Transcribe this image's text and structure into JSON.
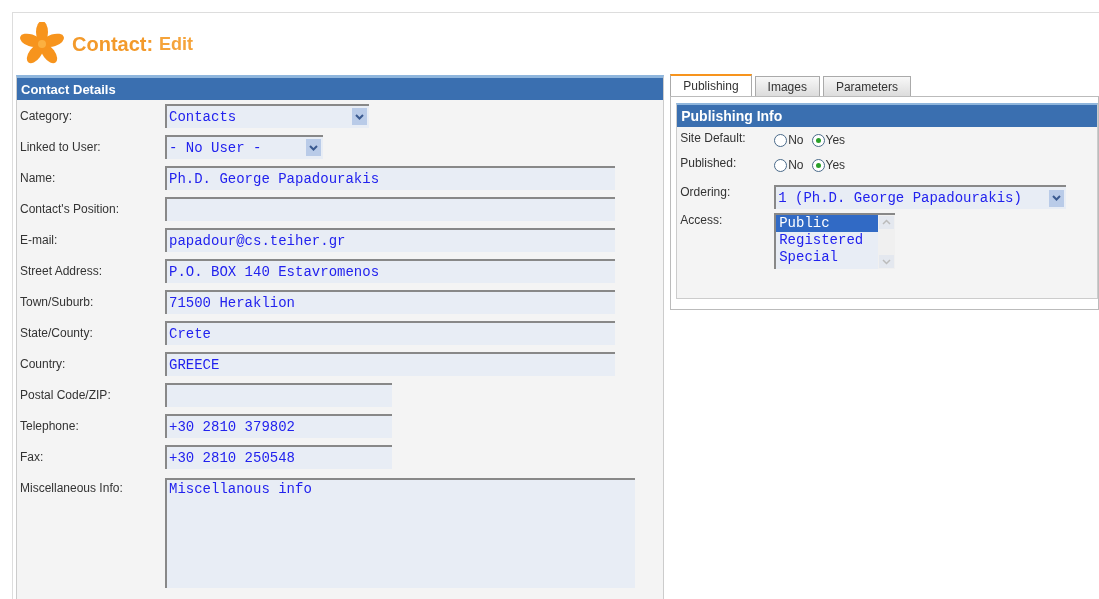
{
  "header": {
    "title": "Contact:",
    "subtitle": "Edit"
  },
  "contact_details": {
    "title": "Contact Details",
    "fields": [
      {
        "label": "Category:",
        "kind": "select",
        "value": "Contacts"
      },
      {
        "label": "Linked to User:",
        "kind": "short-select",
        "value": "- No User -"
      },
      {
        "label": "Name:",
        "kind": "text",
        "value": "Ph.D. George Papadourakis"
      },
      {
        "label": "Contact's Position:",
        "kind": "text"
      },
      {
        "label": "E-mail:",
        "kind": "text",
        "value": "papadour@cs.teiher.gr"
      },
      {
        "label": "Street Address:",
        "kind": "text",
        "value": "P.O. BOX 140 Estavromenos"
      },
      {
        "label": "Town/Suburb:",
        "kind": "text",
        "value": "71500 Heraklion"
      },
      {
        "label": "State/County:",
        "kind": "text",
        "value": "Crete"
      },
      {
        "label": "Country:",
        "kind": "text",
        "value": "GREECE"
      },
      {
        "label": "Postal Code/ZIP:",
        "kind": "short-text"
      },
      {
        "label": "Telephone:",
        "kind": "short-text",
        "value": "+30 2810 379802"
      },
      {
        "label": "Fax:",
        "kind": "short-text",
        "value": "+30 2810 250548"
      },
      {
        "label": "Miscellaneous Info:",
        "kind": "textarea",
        "value": "Miscellanous info"
      }
    ]
  },
  "tabs": [
    {
      "label": "Publishing",
      "selected": true
    },
    {
      "label": "Images",
      "selected": false
    },
    {
      "label": "Parameters",
      "selected": false
    }
  ],
  "publishing_info": {
    "title": "Publishing Info",
    "rows": [
      {
        "label": "Site Default:",
        "kind": "radio",
        "options": [
          {
            "label": "No",
            "selected": false
          },
          {
            "label": "Yes",
            "selected": true
          }
        ]
      },
      {
        "label": "Published:",
        "kind": "radio",
        "options": [
          {
            "label": "No",
            "selected": false
          },
          {
            "label": "Yes",
            "selected": true
          }
        ]
      },
      {
        "label": "Ordering:",
        "kind": "select",
        "value": "1 (Ph.D. George Papadourakis)"
      },
      {
        "label": "Access:",
        "kind": "listbox",
        "options": [
          {
            "label": "Public",
            "selected": true
          },
          {
            "label": "Registered",
            "selected": false
          },
          {
            "label": "Special",
            "selected": false
          }
        ]
      }
    ]
  }
}
